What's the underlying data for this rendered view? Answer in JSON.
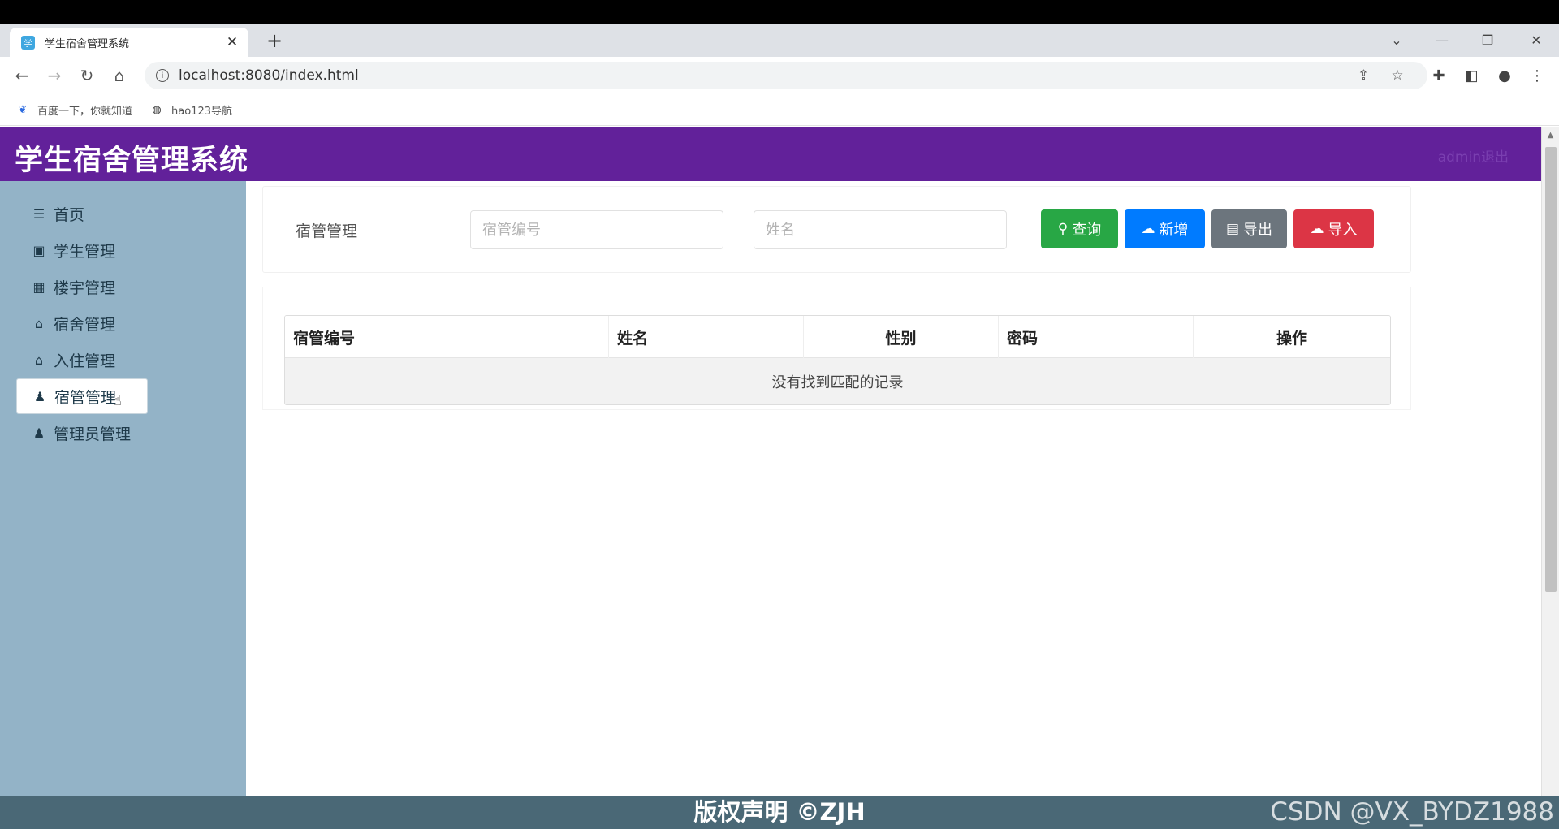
{
  "browser": {
    "tab_title": "学生宿舍管理系统",
    "tab_close": "✕",
    "new_tab": "+",
    "url": "localhost:8080/index.html",
    "bookmarks": [
      {
        "label": "百度一下，你就知道",
        "icon": "paw-icon"
      },
      {
        "label": "hao123导航",
        "icon": "globe-icon"
      }
    ]
  },
  "header": {
    "title": "学生宿舍管理系统",
    "user_link": "admin退出"
  },
  "sidebar": {
    "items": [
      {
        "label": "首页",
        "icon": "menu-icon"
      },
      {
        "label": "学生管理",
        "icon": "id-card-icon"
      },
      {
        "label": "楼宇管理",
        "icon": "bank-icon"
      },
      {
        "label": "宿舍管理",
        "icon": "home-icon"
      },
      {
        "label": "入住管理",
        "icon": "home-icon"
      },
      {
        "label": "宿管管理",
        "icon": "user-icon",
        "active": true
      },
      {
        "label": "管理员管理",
        "icon": "user-icon"
      }
    ]
  },
  "search": {
    "panel_label": "宿管管理",
    "id_placeholder": "宿管编号",
    "name_placeholder": "姓名",
    "buttons": {
      "query": "查询",
      "add": "新增",
      "export": "导出",
      "import": "导入"
    },
    "colors": {
      "query": "#28a745",
      "add": "#007bff",
      "export": "#6c757d",
      "import": "#dc3545"
    }
  },
  "table": {
    "columns": [
      "宿管编号",
      "姓名",
      "性别",
      "密码",
      "操作"
    ],
    "empty_text": "没有找到匹配的记录"
  },
  "footer": {
    "text": "版权声明 ©ZJH",
    "watermark": "CSDN @VX_BYDZ1988"
  },
  "colors": {
    "header_bg": "#62219a",
    "sidebar_bg": "#93b3c7",
    "footer_bg": "#4a6876"
  }
}
